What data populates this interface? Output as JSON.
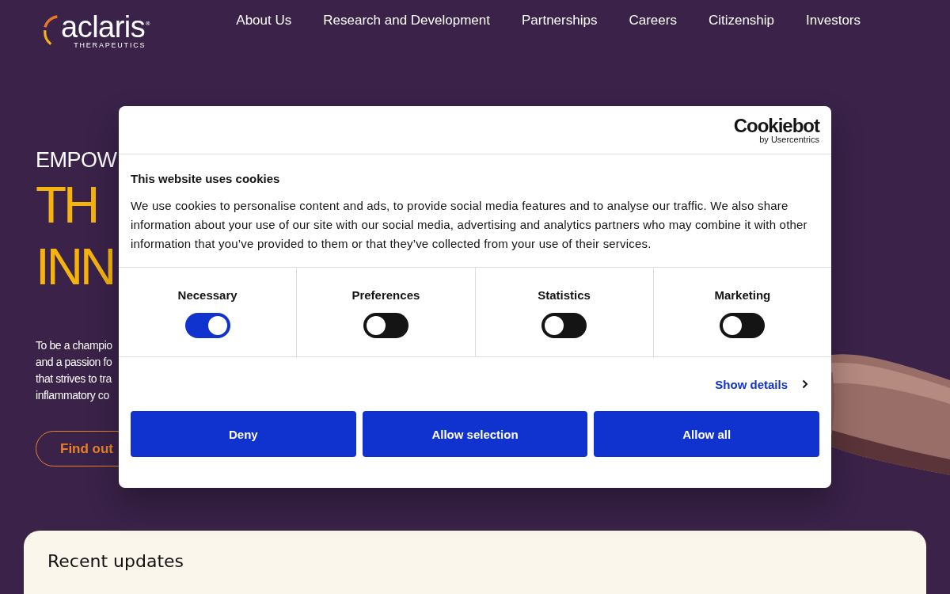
{
  "logo": {
    "name": "aclaris",
    "registered": "®",
    "tagline": "THERAPEUTICS"
  },
  "nav": [
    "About Us",
    "Research and Development",
    "Partnerships",
    "Careers",
    "Citizenship",
    "Investors"
  ],
  "hero": {
    "eyebrow": "EMPOW",
    "headline": [
      "TH",
      "INN"
    ],
    "paragraph": [
      "To be a champio",
      "and a passion fo",
      "that strives to tra",
      "inflammatory co"
    ],
    "button": "Find out"
  },
  "cookie_dialog": {
    "brand": "Cookiebot",
    "brand_sub": "by Usercentrics",
    "title": "This website uses cookies",
    "text": "We use cookies to personalise content and ads, to provide social media features and to analyse our traffic. We also share information about your use of our site with our social media, advertising and analytics partners who may combine it with other information that you’ve provided to them or that they’ve collected from your use of their services.",
    "categories": [
      {
        "label": "Necessary",
        "checked": true
      },
      {
        "label": "Preferences",
        "checked": false
      },
      {
        "label": "Statistics",
        "checked": false
      },
      {
        "label": "Marketing",
        "checked": false
      }
    ],
    "details_link": "Show details",
    "buttons": [
      "Deny",
      "Allow selection",
      "Allow all"
    ]
  },
  "updates": {
    "title": "Recent updates"
  }
}
